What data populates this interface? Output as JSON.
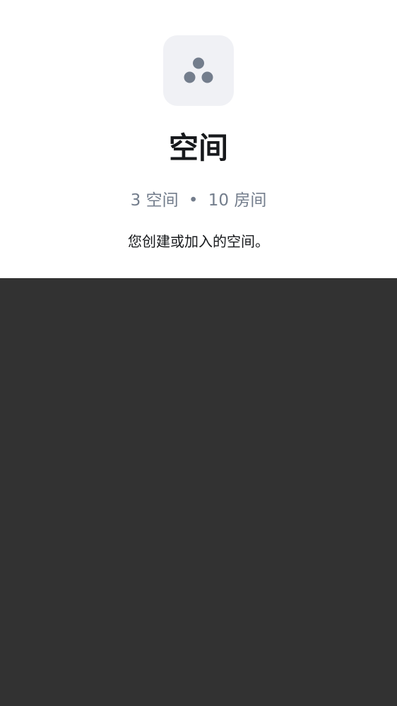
{
  "header": {
    "title": "空间",
    "stats": {
      "spaces": "3 空间",
      "separator": "•",
      "rooms": "10 房间"
    },
    "description": "您创建或加入的空间。",
    "icon": "spaces-icon"
  },
  "colors": {
    "panel_background": "#ffffff",
    "page_background": "#323232",
    "avatar_background": "#f0f1f5",
    "icon_color": "#737d8c",
    "title_color": "#17191c",
    "secondary_text": "#737d8c"
  }
}
